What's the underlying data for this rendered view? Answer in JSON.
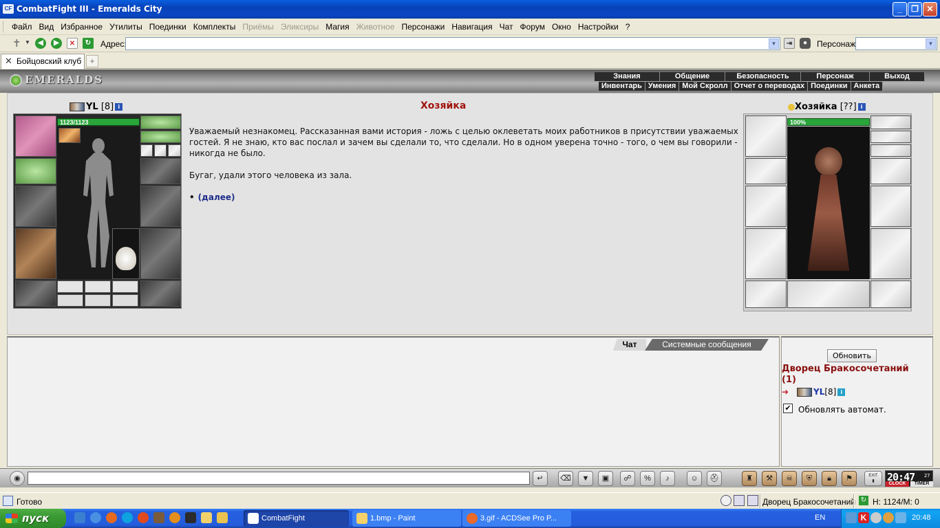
{
  "window": {
    "title": "CombatFight III - Emeralds City",
    "app_icon": "CF"
  },
  "menu": [
    "Файл",
    "Вид",
    "Избранное",
    "Утилиты",
    "Поединки",
    "Комплекты",
    "Приёмы",
    "Эликсиры",
    "Магия",
    "Животное",
    "Персонажи",
    "Навигация",
    "Чат",
    "Форум",
    "Окно",
    "Настройки",
    "?"
  ],
  "menu_disabled": [
    "Приёмы",
    "Эликсиры",
    "Животное"
  ],
  "address": {
    "label": "Адрес:",
    "value": "",
    "persona_label": "Персонаж:",
    "persona_value": ""
  },
  "tabs": [
    {
      "label": "Бойцовский клуб",
      "active": true
    }
  ],
  "game": {
    "logo": "EMERALDS",
    "nav_top": [
      "Знания",
      "Общение",
      "Безопасность",
      "Персонаж",
      "Выход"
    ],
    "nav_sub": [
      "Инвентарь",
      "Умения",
      "Мой Скролл",
      "Отчет о переводах",
      "Поединки",
      "Анкета"
    ]
  },
  "player": {
    "name": "YL",
    "level": "[8]",
    "hp": "1123/1123",
    "hp_fraction": 1.0
  },
  "npc": {
    "name": "Хозяйка",
    "level": "[??]",
    "hp": "100%",
    "hp_fraction": 1.0
  },
  "dialog": {
    "title": "Хозяйка",
    "paragraphs": [
      "Уважаемый незнакомец. Рассказанная вами история - ложь с целью оклеветать моих работников в присутствии уважаемых гостей. Я не знаю, кто вас послал и зачем вы сделали то, что сделали. Но в одном уверена точно - того, о чем вы говорили - никогда не было.",
      "Бугаг, удали этого человека из зала."
    ],
    "link": "(далее)"
  },
  "chat": {
    "tabs": [
      "Чат",
      "Системные сообщения"
    ],
    "active_tab": "Чат",
    "input_value": ""
  },
  "online": {
    "refresh_label": "Обновить",
    "room": "Дворец Бракосочетаний",
    "count": "(1)",
    "users": [
      {
        "name": "YL",
        "level": "[8]"
      }
    ],
    "auto_label": "Обновлять автомат.",
    "auto_checked": true
  },
  "clock": {
    "time": "20:47",
    "seconds": "27",
    "label_left": "CLOCK",
    "label_right": "TIMER"
  },
  "exit_label": "EXIT",
  "status": {
    "text": "Готово",
    "location": "Дворец Бракосочетаний",
    "hm": "Н: 1124/М: 0"
  },
  "taskbar": {
    "start": "пуск",
    "tasks": [
      "CombatFight",
      "1.bmp - Paint",
      "3.gif - ACDSee Pro P..."
    ],
    "lang": "EN",
    "time": "20:48"
  },
  "colors": {
    "title_bar": "#0842b8",
    "npc_title": "#a0140e",
    "room": "#8a0f0f",
    "link": "#1f2f8a",
    "hp": "#2aa53a"
  }
}
